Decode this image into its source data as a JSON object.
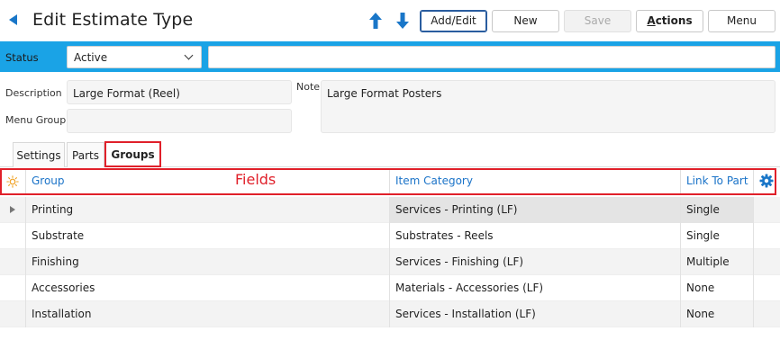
{
  "header": {
    "title": "Edit Estimate Type",
    "buttons": {
      "add_edit": "Add/Edit",
      "new": "New",
      "save": "Save",
      "actions_first": "A",
      "actions_rest": "ctions",
      "menu": "Menu"
    }
  },
  "status_bar": {
    "label": "Status",
    "value": "Active",
    "text": ""
  },
  "form": {
    "description_label": "Description",
    "description_value": "Large Format (Reel)",
    "menu_group_label": "Menu Group",
    "menu_group_value": "",
    "note_label": "Note",
    "note_value": "Large Format Posters"
  },
  "tabs": [
    {
      "label": "Settings"
    },
    {
      "label": "Parts"
    },
    {
      "label": "Groups",
      "active": true
    }
  ],
  "annotation": "Fields",
  "grid": {
    "columns": [
      "Group",
      "Item Category",
      "Link To Part"
    ],
    "rows": [
      {
        "group": "Printing",
        "item_category": "Services - Printing (LF)",
        "link_to_part": "Single"
      },
      {
        "group": "Substrate",
        "item_category": "Substrates - Reels",
        "link_to_part": "Single"
      },
      {
        "group": "Finishing",
        "item_category": "Services - Finishing (LF)",
        "link_to_part": "Multiple"
      },
      {
        "group": "Accessories",
        "item_category": "Materials - Accessories (LF)",
        "link_to_part": "None"
      },
      {
        "group": "Installation",
        "item_category": "Services - Installation (LF)",
        "link_to_part": "None"
      }
    ]
  },
  "colors": {
    "accent_blue": "#1976c8",
    "status_bar": "#1aa3e6",
    "annotation_red": "#e0202a",
    "sun_orange": "#f0a020"
  },
  "icons": [
    "back-icon",
    "arrow-up-icon",
    "arrow-down-icon",
    "chevron-down-icon",
    "sun-icon",
    "gear-icon",
    "expand-row-icon"
  ]
}
